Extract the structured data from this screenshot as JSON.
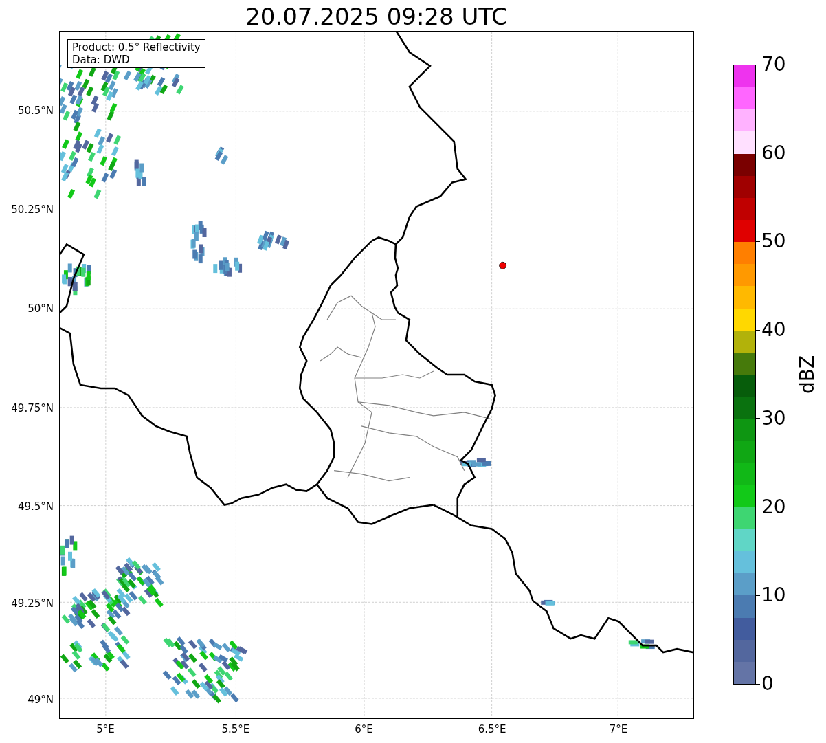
{
  "title": "20.07.2025 09:28 UTC",
  "legend": [
    "Product: 0.5° Reflectivity",
    "Data: DWD"
  ],
  "x_ticks": [
    "5°E",
    "5.5°E",
    "6°E",
    "6.5°E",
    "7°E"
  ],
  "y_ticks": [
    "50.5°N",
    "50.25°N",
    "50°N",
    "49.75°N",
    "49.5°N",
    "49.25°N",
    "49°N"
  ],
  "colorbar": {
    "label": "dBZ",
    "ticks": [
      "70",
      "60",
      "50",
      "40",
      "30",
      "20",
      "10",
      "0"
    ],
    "bands": [
      {
        "color": "#ee33ee"
      },
      {
        "color": "#ff66ff"
      },
      {
        "color": "#ffb2ff"
      },
      {
        "color": "#ffe0ff"
      },
      {
        "color": "#7a0000"
      },
      {
        "color": "#a00000"
      },
      {
        "color": "#c00000"
      },
      {
        "color": "#e00000"
      },
      {
        "color": "#ff7f00"
      },
      {
        "color": "#ff9900"
      },
      {
        "color": "#ffb900"
      },
      {
        "color": "#ffd800"
      },
      {
        "color": "#b2b20a"
      },
      {
        "color": "#467a0b"
      },
      {
        "color": "#075d0b"
      },
      {
        "color": "#0a720f"
      },
      {
        "color": "#0e9612"
      },
      {
        "color": "#10a714"
      },
      {
        "color": "#11b817"
      },
      {
        "color": "#12c918"
      },
      {
        "color": "#3ed672"
      },
      {
        "color": "#60d6c6"
      },
      {
        "color": "#65c0dc"
      },
      {
        "color": "#5b9ec8"
      },
      {
        "color": "#4b7bb1"
      },
      {
        "color": "#425c9e"
      },
      {
        "color": "#53679e"
      },
      {
        "color": "#6474a6"
      }
    ]
  }
}
